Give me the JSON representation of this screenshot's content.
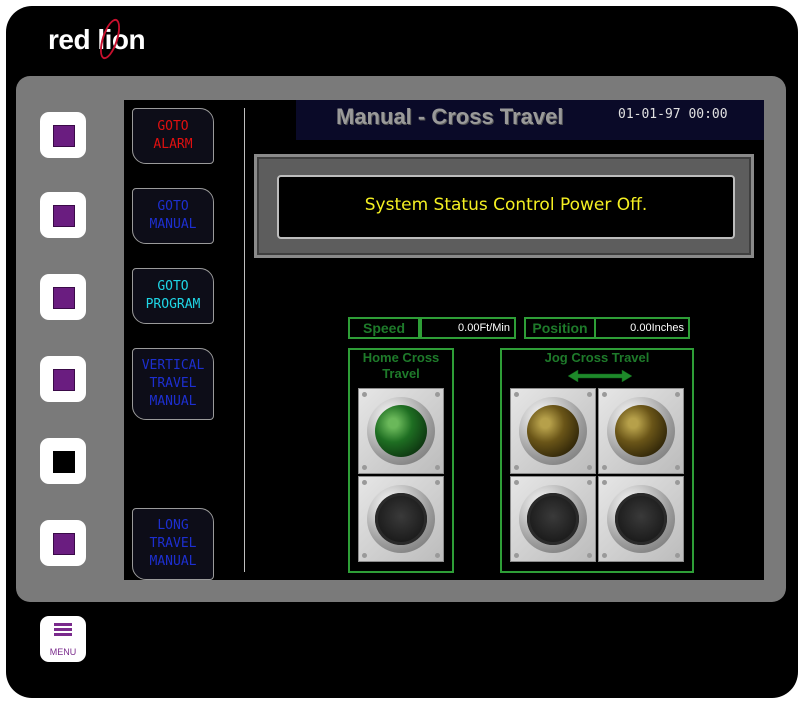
{
  "brand": {
    "logo_text_pre": "red l",
    "logo_text_mid": "i",
    "logo_text_post": "on"
  },
  "hardware": {
    "softkeys": [
      "F1",
      "F2",
      "F3",
      "F4",
      "F5",
      "F6"
    ],
    "menu_label": "MENU"
  },
  "screen": {
    "title": "Manual - Cross Travel",
    "datetime": "01-01-97 00:00",
    "nav": [
      {
        "label": "GOTO\nALARM",
        "color": "#e01010"
      },
      {
        "label": "GOTO\nMANUAL",
        "color": "#1d2fd0"
      },
      {
        "label": "GOTO\nPROGRAM",
        "color": "#1fd6e6"
      },
      {
        "label": "VERTICAL\nTRAVEL\nMANUAL",
        "color": "#1d2fd0"
      },
      {
        "label": "LONG\nTRAVEL\nMANUAL",
        "color": "#1d2fd0"
      }
    ],
    "status_message": "System Status Control Power Off.",
    "speed_label": "Speed",
    "speed_value": "0.00Ft/Min",
    "position_label": "Position",
    "position_value": "0.00Inches",
    "home_panel_title": "Home Cross\nTravel",
    "jog_panel_title": "Jog Cross Travel"
  },
  "colors": {
    "accent_green": "#2e9e37",
    "label_green": "#1e7a2a",
    "status_yellow": "#f5f022",
    "softkey_purple": "#6a1d80"
  },
  "icons": {
    "arrow": "double-arrow-left-right-icon",
    "menu": "menu-icon"
  }
}
